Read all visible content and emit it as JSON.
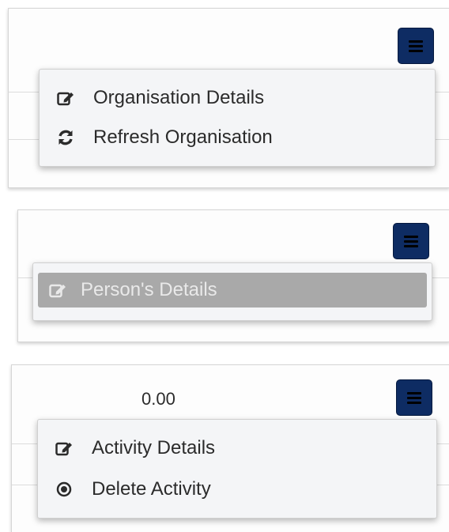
{
  "organisation_panel": {
    "menu_button_icon": "hamburger-menu-icon",
    "items": [
      {
        "label": "Organisation Details",
        "icon": "edit-icon"
      },
      {
        "label": "Refresh Organisation",
        "icon": "refresh-icon"
      }
    ]
  },
  "person_panel": {
    "menu_button_icon": "hamburger-menu-icon",
    "items": [
      {
        "label": "Person's Details",
        "icon": "edit-icon",
        "disabled": true
      }
    ]
  },
  "activity_panel": {
    "value": "0.00",
    "menu_button_icon": "hamburger-menu-icon",
    "items": [
      {
        "label": "Activity Details",
        "icon": "edit-icon"
      },
      {
        "label": "Delete Activity",
        "icon": "remove-circle-icon"
      }
    ]
  },
  "colors": {
    "menu_button": "#0e2c63",
    "disabled_item": "#a9a9a9"
  }
}
